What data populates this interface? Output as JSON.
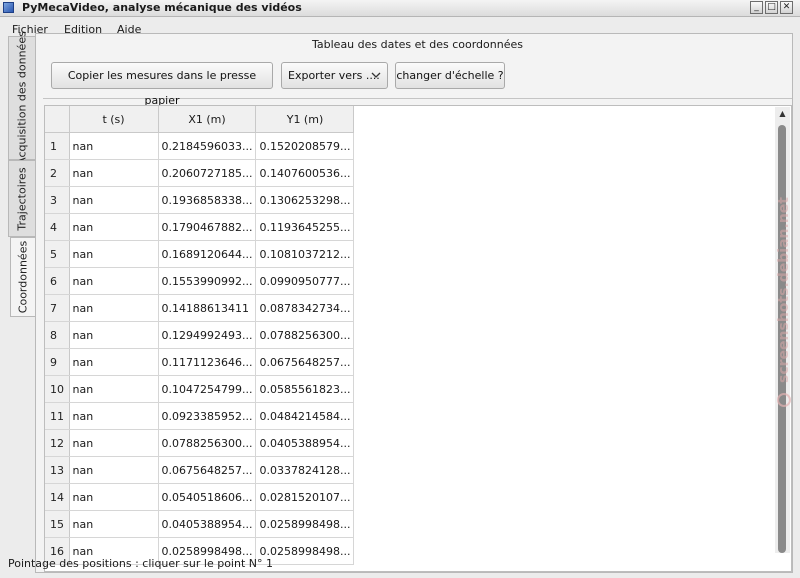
{
  "window": {
    "title": "PyMecaVideo, analyse mécanique des vidéos",
    "buttons": {
      "minimize": "_",
      "maximize": "□",
      "close": "✕"
    }
  },
  "menu": [
    "Fichier",
    "Edition",
    "Aide"
  ],
  "tabs": [
    "Acquisition des données",
    "Trajectoires",
    "Coordonnées"
  ],
  "active_tab": "Coordonnées",
  "group_title": "Tableau des dates et des coordonnées",
  "buttons": {
    "copy": "Copier les mesures dans le presse papier",
    "export": "Exporter vers ....",
    "scale": "changer d'échelle ?"
  },
  "table": {
    "headers": [
      "t (s)",
      "X1 (m)",
      "Y1 (m)"
    ],
    "rows": [
      {
        "n": "1",
        "t": "nan",
        "x": "0.2184596033...",
        "y": "0.1520208579..."
      },
      {
        "n": "2",
        "t": "nan",
        "x": "0.2060727185...",
        "y": "0.1407600536..."
      },
      {
        "n": "3",
        "t": "nan",
        "x": "0.1936858338...",
        "y": "0.1306253298..."
      },
      {
        "n": "4",
        "t": "nan",
        "x": "0.1790467882...",
        "y": "0.1193645255..."
      },
      {
        "n": "5",
        "t": "nan",
        "x": "0.1689120644...",
        "y": "0.1081037212..."
      },
      {
        "n": "6",
        "t": "nan",
        "x": "0.1553990992...",
        "y": "0.0990950777..."
      },
      {
        "n": "7",
        "t": "nan",
        "x": "0.14188613411",
        "y": "0.0878342734..."
      },
      {
        "n": "8",
        "t": "nan",
        "x": "0.1294992493...",
        "y": "0.0788256300..."
      },
      {
        "n": "9",
        "t": "nan",
        "x": "0.1171123646...",
        "y": "0.0675648257..."
      },
      {
        "n": "10",
        "t": "nan",
        "x": "0.1047254799...",
        "y": "0.0585561823..."
      },
      {
        "n": "11",
        "t": "nan",
        "x": "0.0923385952...",
        "y": "0.0484214584..."
      },
      {
        "n": "12",
        "t": "nan",
        "x": "0.0788256300...",
        "y": "0.0405388954..."
      },
      {
        "n": "13",
        "t": "nan",
        "x": "0.0675648257...",
        "y": "0.0337824128..."
      },
      {
        "n": "14",
        "t": "nan",
        "x": "0.0540518606...",
        "y": "0.0281520107..."
      },
      {
        "n": "15",
        "t": "nan",
        "x": "0.0405388954...",
        "y": "0.0258998498..."
      },
      {
        "n": "16",
        "t": "nan",
        "x": "0.0258998498...",
        "y": "0.0258998498..."
      }
    ]
  },
  "status": "Pointage des positions : cliquer sur le point N° 1",
  "watermark": "screenshots.debian.net",
  "icons": {
    "app": "app-icon",
    "export_dropdown": "chevron-down-icon",
    "scroll_up": "arrow-up-icon"
  }
}
